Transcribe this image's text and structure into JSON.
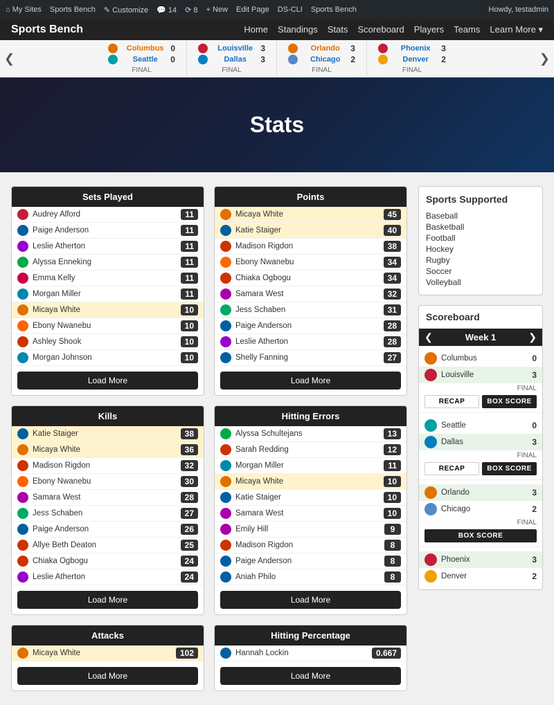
{
  "adminBar": {
    "left": [
      "My Sites",
      "Sports Bench",
      "Customize",
      "14",
      "8",
      "+New",
      "Edit Page",
      "DS-CLI",
      "Sports Bench"
    ],
    "right": "Howdy, testadmin"
  },
  "header": {
    "logo": "Sports Bench",
    "nav": [
      "Home",
      "Standings",
      "Stats",
      "Scoreboard",
      "Players",
      "Teams",
      "Learn More ▾"
    ]
  },
  "ticker": {
    "leftArrow": "❮",
    "rightArrow": "❯",
    "games": [
      {
        "teams": [
          {
            "name": "Columbus",
            "score": "0",
            "color": "orange"
          },
          {
            "name": "Seattle",
            "score": "0",
            "color": "teal"
          }
        ],
        "status": "FINAL"
      },
      {
        "teams": [
          {
            "name": "Louisville",
            "score": "3",
            "color": "red"
          },
          {
            "name": "Dallas",
            "score": "3",
            "color": "blue"
          }
        ],
        "status": "FINAL"
      },
      {
        "teams": [
          {
            "name": "Orlando",
            "score": "3",
            "color": "orange"
          },
          {
            "name": "Chicago",
            "score": "2",
            "color": "blue"
          }
        ],
        "status": "FINAL"
      },
      {
        "teams": [
          {
            "name": "Phoenix",
            "score": "3",
            "color": "red"
          },
          {
            "name": "Denver",
            "score": "2",
            "color": "yellow"
          }
        ],
        "status": "FINAL"
      }
    ]
  },
  "hero": {
    "title": "Stats"
  },
  "setsPlayed": {
    "title": "Sets Played",
    "rows": [
      {
        "name": "Audrey Alford",
        "value": "11",
        "tc": "tc-audrey"
      },
      {
        "name": "Paige Anderson",
        "value": "11",
        "tc": "tc-paige"
      },
      {
        "name": "Leslie Atherton",
        "value": "11",
        "tc": "tc-leslie"
      },
      {
        "name": "Alyssa Enneking",
        "value": "11",
        "tc": "tc-alyssa"
      },
      {
        "name": "Emma Kelly",
        "value": "11",
        "tc": "tc-emma"
      },
      {
        "name": "Morgan Miller",
        "value": "11",
        "tc": "tc-morgan"
      },
      {
        "name": "Micaya White",
        "value": "10",
        "tc": "tc-micaya",
        "highlight": true
      },
      {
        "name": "Ebony Nwanebu",
        "value": "10",
        "tc": "tc-ebony"
      },
      {
        "name": "Ashley Shook",
        "value": "10",
        "tc": "tc-ashley"
      },
      {
        "name": "Morgan Johnson",
        "value": "10",
        "tc": "tc-morgan"
      }
    ],
    "loadMore": "Load More"
  },
  "points": {
    "title": "Points",
    "rows": [
      {
        "name": "Micaya White",
        "value": "45",
        "tc": "tc-micaya",
        "highlight": true
      },
      {
        "name": "Katie Staiger",
        "value": "40",
        "tc": "tc-katie",
        "highlight": true
      },
      {
        "name": "Madison Rigdon",
        "value": "38",
        "tc": "tc-madison"
      },
      {
        "name": "Ebony Nwanebu",
        "value": "34",
        "tc": "tc-ebony"
      },
      {
        "name": "Chiaka Ogbogu",
        "value": "34",
        "tc": "tc-chiaka"
      },
      {
        "name": "Samara West",
        "value": "32",
        "tc": "tc-samara"
      },
      {
        "name": "Jess Schaben",
        "value": "31",
        "tc": "tc-jess"
      },
      {
        "name": "Paige Anderson",
        "value": "28",
        "tc": "tc-paige"
      },
      {
        "name": "Leslie Atherton",
        "value": "28",
        "tc": "tc-leslie"
      },
      {
        "name": "Shelly Fanning",
        "value": "27",
        "tc": "tc-shelly"
      }
    ],
    "loadMore": "Load More"
  },
  "kills": {
    "title": "Kills",
    "rows": [
      {
        "name": "Katie Staiger",
        "value": "38",
        "tc": "tc-katie",
        "highlight": true
      },
      {
        "name": "Micaya White",
        "value": "36",
        "tc": "tc-micaya",
        "highlight": true
      },
      {
        "name": "Madison Rigdon",
        "value": "32",
        "tc": "tc-madison"
      },
      {
        "name": "Ebony Nwanebu",
        "value": "30",
        "tc": "tc-ebony"
      },
      {
        "name": "Samara West",
        "value": "28",
        "tc": "tc-samara"
      },
      {
        "name": "Jess Schaben",
        "value": "27",
        "tc": "tc-jess"
      },
      {
        "name": "Paige Anderson",
        "value": "26",
        "tc": "tc-paige"
      },
      {
        "name": "Allye Beth Deaton",
        "value": "25",
        "tc": "tc-allye"
      },
      {
        "name": "Chiaka Ogbogu",
        "value": "24",
        "tc": "tc-chiaka"
      },
      {
        "name": "Leslie Atherton",
        "value": "24",
        "tc": "tc-leslie"
      }
    ],
    "loadMore": "Load More"
  },
  "hittingErrors": {
    "title": "Hitting Errors",
    "rows": [
      {
        "name": "Alyssa Schultejans",
        "value": "13",
        "tc": "tc-alyssa"
      },
      {
        "name": "Sarah Redding",
        "value": "12",
        "tc": "tc-sarah"
      },
      {
        "name": "Morgan Miller",
        "value": "11",
        "tc": "tc-morgan"
      },
      {
        "name": "Micaya White",
        "value": "10",
        "tc": "tc-micaya",
        "highlight": true
      },
      {
        "name": "Katie Staiger",
        "value": "10",
        "tc": "tc-katie"
      },
      {
        "name": "Samara West",
        "value": "10",
        "tc": "tc-samara"
      },
      {
        "name": "Emily Hill",
        "value": "9",
        "tc": "tc-emily"
      },
      {
        "name": "Madison Rigdon",
        "value": "8",
        "tc": "tc-madison"
      },
      {
        "name": "Paige Anderson",
        "value": "8",
        "tc": "tc-paige"
      },
      {
        "name": "Aniah Philo",
        "value": "8",
        "tc": "tc-aniah"
      }
    ],
    "loadMore": "Load More"
  },
  "attacks": {
    "title": "Attacks",
    "rows": [
      {
        "name": "Micaya White",
        "value": "102",
        "tc": "tc-micaya",
        "highlight": true
      }
    ],
    "loadMore": "Load More"
  },
  "hittingPct": {
    "title": "Hitting Percentage",
    "rows": [
      {
        "name": "Hannah Lockin",
        "value": "0.667",
        "tc": "tc-hannah"
      }
    ],
    "loadMore": "Load More"
  },
  "sidebar": {
    "sportsSupported": {
      "title": "Sports Supported",
      "sports": [
        "Baseball",
        "Basketball",
        "Football",
        "Hockey",
        "Rugby",
        "Soccer",
        "Volleyball"
      ]
    },
    "scoreboard": {
      "title": "Scoreboard",
      "weekLabel": "Week 1",
      "leftArrow": "❮",
      "rightArrow": "❯",
      "games": [
        {
          "teams": [
            {
              "name": "Columbus",
              "score": "0",
              "tc": "tc-columbus"
            },
            {
              "name": "Louisville",
              "score": "3",
              "tc": "tc-louisville",
              "winner": true
            }
          ],
          "status": "FINAL",
          "recap": "RECAP",
          "boxScore": "BOX SCORE",
          "hasRecap": true
        },
        {
          "teams": [
            {
              "name": "Seattle",
              "score": "0",
              "tc": "tc-seattle"
            },
            {
              "name": "Dallas",
              "score": "3",
              "tc": "tc-dallas",
              "winner": true
            }
          ],
          "status": "FINAL",
          "recap": "RECAP",
          "boxScore": "BOX SCORE",
          "hasRecap": true
        },
        {
          "teams": [
            {
              "name": "Orlando",
              "score": "3",
              "tc": "tc-orlando",
              "winner": true
            },
            {
              "name": "Chicago",
              "score": "2",
              "tc": "tc-chicago"
            }
          ],
          "status": "FINAL",
          "recap": "",
          "boxScore": "BOX SCORE",
          "hasRecap": false
        },
        {
          "teams": [
            {
              "name": "Phoenix",
              "score": "3",
              "tc": "tc-phoenix",
              "winner": true
            },
            {
              "name": "Denver",
              "score": "2",
              "tc": "tc-denver"
            }
          ],
          "status": "",
          "recap": "",
          "boxScore": "",
          "hasRecap": false
        }
      ]
    }
  }
}
